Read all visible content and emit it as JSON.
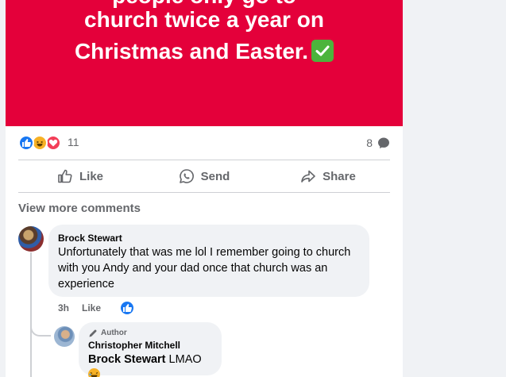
{
  "post": {
    "image_text": {
      "line1": "people only go to",
      "line2": "church twice a year on",
      "line3": "Christmas and Easter.",
      "check_icon": "check-mark-button-emoji"
    },
    "reactions": {
      "icons": [
        "like",
        "haha",
        "love"
      ],
      "count": "11"
    },
    "comments_count": "8",
    "actions": {
      "like": "Like",
      "send": "Send",
      "share": "Share"
    }
  },
  "comments": {
    "view_more": "View more comments",
    "first": {
      "author": "Brock Stewart",
      "text": "Unfortunately that was me lol I remember going to church with you Andy and your dad once that church was an experience",
      "time": "3h",
      "like_label": "Like",
      "reaction": "like"
    },
    "reply": {
      "badge": "Author",
      "author": "Christopher Mitchell",
      "mention": "Brock Stewart",
      "text": "LMAO",
      "emoji": "rolling-laughing"
    }
  },
  "colors": {
    "media_bg": "#e4003a",
    "like_blue": "#1877f2",
    "muted_text": "#65676b",
    "bubble_bg": "#f0f2f5"
  }
}
